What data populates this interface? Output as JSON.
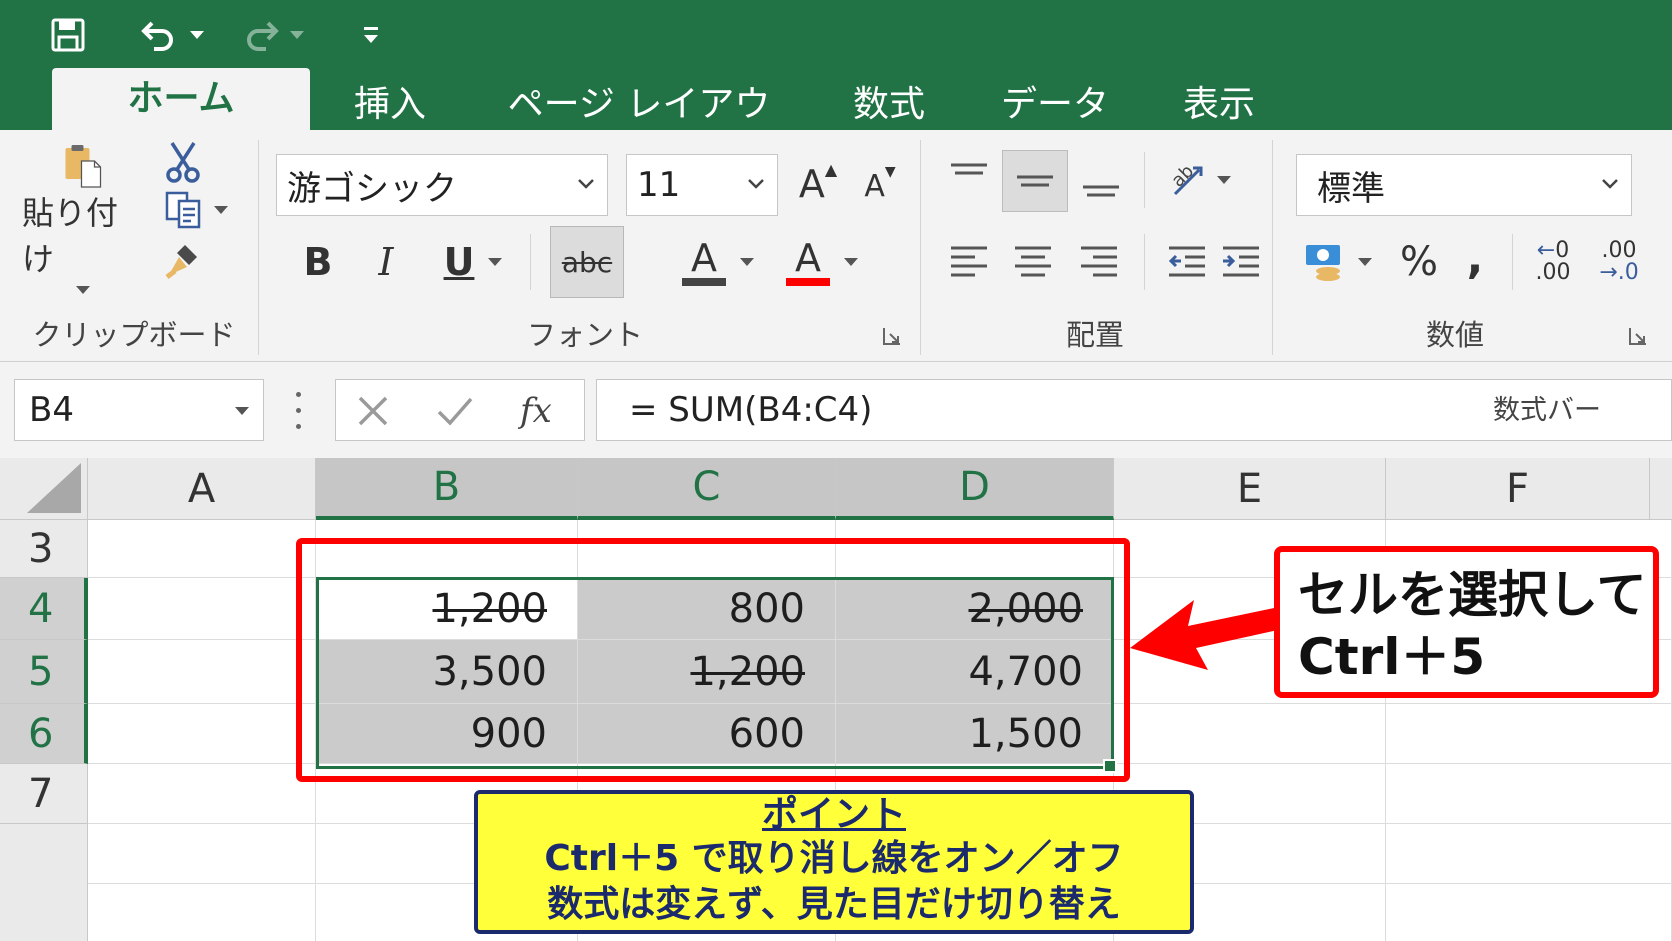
{
  "tabs": [
    {
      "label": "ホーム",
      "active": true
    },
    {
      "label": "挿入",
      "active": false
    },
    {
      "label": "ページ レイアウト",
      "active": false
    },
    {
      "label": "数式",
      "active": false
    },
    {
      "label": "データ",
      "active": false
    },
    {
      "label": "表示",
      "active": false
    }
  ],
  "qat": {
    "icons": [
      "save-icon",
      "undo-icon",
      "redo-icon",
      "customize-icon"
    ]
  },
  "clipboard": {
    "paste_label": "貼り付け",
    "group_label": "クリップボード"
  },
  "font": {
    "name": "游ゴシック",
    "size": "11",
    "group_label": "フォント",
    "bold": "B",
    "italic": "I",
    "underline": "U",
    "strike": "abc",
    "grow": "A",
    "shrink": "A",
    "highlight": "A",
    "fontcolor": "A"
  },
  "alignment": {
    "group_label": "配置"
  },
  "number": {
    "format": "標準",
    "group_label": "数値",
    "percent": "%",
    "comma": ",",
    "inc_decimal": ".00",
    "inc_decimal_sub": ".0",
    "dec_decimal": ".00",
    "dec_decimal_sub": "→.0"
  },
  "formula_bar": {
    "name_box": "B4",
    "formula": "= SUM(B4:C4)",
    "hint": "数式バー"
  },
  "grid": {
    "columns": [
      "A",
      "B",
      "C",
      "D",
      "E",
      "F"
    ],
    "rows": [
      "3",
      "4",
      "5",
      "6",
      "7"
    ],
    "cells": {
      "B4": {
        "value": "1,200",
        "strike": true
      },
      "C4": {
        "value": "800",
        "strike": false
      },
      "D4": {
        "value": "2,000",
        "strike": true
      },
      "B5": {
        "value": "3,500",
        "strike": false
      },
      "C5": {
        "value": "1,200",
        "strike": true
      },
      "D5": {
        "value": "4,700",
        "strike": false
      },
      "B6": {
        "value": "900",
        "strike": false
      },
      "C6": {
        "value": "600",
        "strike": false
      },
      "D6": {
        "value": "1,500",
        "strike": false
      }
    }
  },
  "callout": {
    "line1": "セルを選択して",
    "line2": "Ctrl＋5"
  },
  "note": {
    "title": "ポイント",
    "line1": "Ctrl＋5 で取り消し線をオン／オフ",
    "line2": "数式は変えず、見た目だけ切り替え"
  },
  "colors": {
    "excel_green": "#217346",
    "annotation_red": "#ff0000",
    "note_yellow": "#ffff3a",
    "note_navy": "#1a2a6c"
  }
}
